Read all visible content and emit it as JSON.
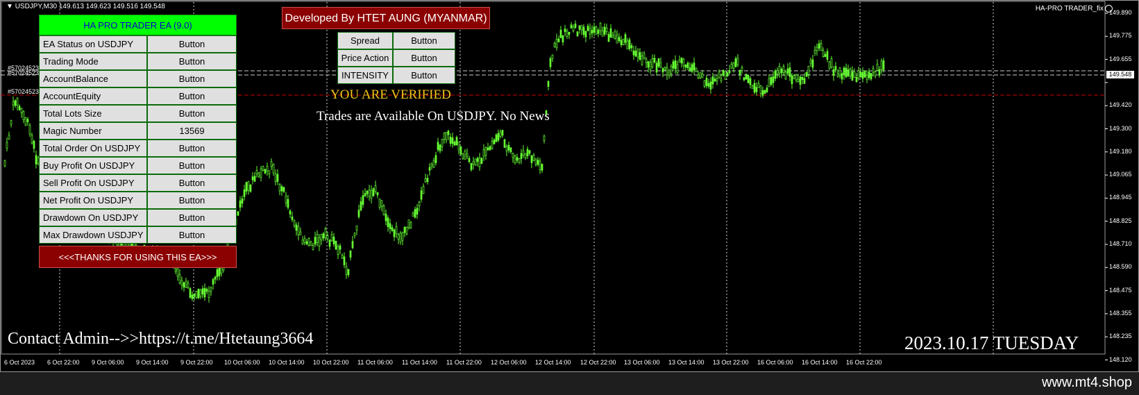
{
  "chart": {
    "symbol_label": "USDJPY,M30",
    "ohlc": "149.613 149.623 149.516 149.548",
    "indicator_name": "HA-PRO TRADER_fix",
    "current_price": "149.548",
    "order_labels": [
      "#57024523",
      "#57024523",
      "#57024523"
    ],
    "y_ticks": [
      "149.890",
      "149.775",
      "149.655",
      "149.548",
      "149.420",
      "149.300",
      "149.180",
      "149.065",
      "148.945",
      "148.825",
      "148.710",
      "148.590",
      "148.475",
      "148.355",
      "148.235",
      "148.120"
    ],
    "x_ticks": [
      "6 Oct 2023",
      "6 Oct 22:00",
      "9 Oct 06:00",
      "9 Oct 14:00",
      "9 Oct 22:00",
      "10 Oct 06:00",
      "10 Oct 14:00",
      "10 Oct 22:00",
      "11 Oct 06:00",
      "11 Oct 14:00",
      "11 Oct 22:00",
      "12 Oct 06:00",
      "12 Oct 14:00",
      "12 Oct 22:00",
      "13 Oct 06:00",
      "13 Oct 14:00",
      "13 Oct 22:00",
      "16 Oct 06:00",
      "16 Oct 14:00",
      "16 Oct 22:00"
    ],
    "colors": {
      "candle": "#66ff33",
      "bid_line": "#cccccc",
      "stop_line": "#cc0000",
      "grid": "#ffffff",
      "axis_text": "#ffffff"
    }
  },
  "panel": {
    "title": "HA PRO TRADER EA (9.0)",
    "rows": [
      {
        "label": "EA Status on USDJPY",
        "value": "Button"
      },
      {
        "label": "Trading Mode",
        "value": "Button"
      },
      {
        "label": "AccountBalance",
        "value": "Button"
      },
      {
        "label": "AccountEquity",
        "value": "Button"
      },
      {
        "label": "Total Lots Size",
        "value": "Button"
      },
      {
        "label": "Magic Number",
        "value": "13569"
      },
      {
        "label": "Total Order On USDJPY",
        "value": "Button"
      },
      {
        "label": "Buy Profit On USDJPY",
        "value": "Button"
      },
      {
        "label": "Sell Profit On USDJPY",
        "value": "Button"
      },
      {
        "label": "Net Profit On USDJPY",
        "value": "Button"
      },
      {
        "label": "Drawdown On USDJPY",
        "value": "Button"
      },
      {
        "label": "Max Drawdown USDJPY",
        "value": "Button"
      }
    ],
    "footer": "<<<THANKS FOR USING THIS EA>>>",
    "colors": {
      "title_bg": "#00ff00",
      "title_text": "#0000d0",
      "footer_bg": "#8b0000",
      "cell_bg": "#e0e0e0",
      "border": "#0a6a0a"
    }
  },
  "developer_banner": "Developed By HTET AUNG (MYANMAR)",
  "info_panel": {
    "rows": [
      {
        "label": "Spread",
        "value": "Button"
      },
      {
        "label": "Price Action",
        "value": "Button"
      },
      {
        "label": "INTENSITY",
        "value": "Button"
      }
    ]
  },
  "status": {
    "verified": "YOU ARE VERIFIED",
    "trades": "Trades are Available On USDJPY. No News"
  },
  "contact": "Contact Admin-->>https://t.me/Htetaung3664",
  "date_label": "2023.10.17 TUESDAY",
  "watermark": "www.mt4.shop",
  "icons": {
    "dropdown": "triangle-down-icon",
    "smile": "smile-icon"
  }
}
